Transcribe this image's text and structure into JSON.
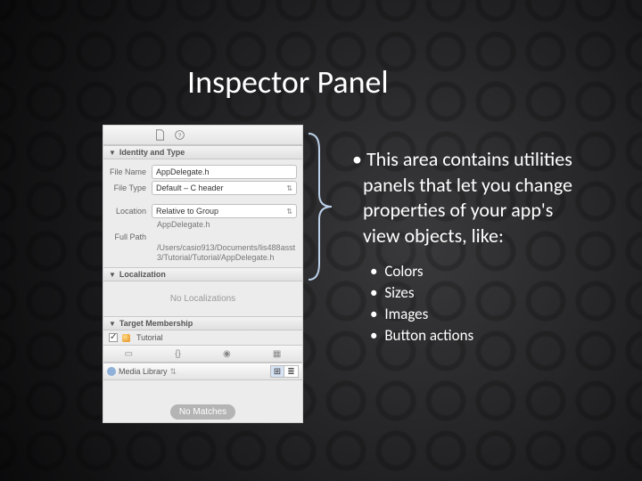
{
  "title": "Inspector Panel",
  "lead": "This area contains utilities panels that let you change properties of your app's view objects, like:",
  "bullets": [
    "Colors",
    "Sizes",
    "Images",
    "Button actions"
  ],
  "panel": {
    "sections": {
      "identity": "Identity and Type",
      "localization": "Localization",
      "target": "Target Membership",
      "media": "Media Library"
    },
    "identity": {
      "file_name_label": "File Name",
      "file_name_value": "AppDelegate.h",
      "file_type_label": "File Type",
      "file_type_value": "Default – C header",
      "location_label": "Location",
      "location_value": "Relative to Group",
      "location_path": "AppDelegate.h",
      "full_path_label": "Full Path",
      "full_path_value": "/Users/casio913/Documents/lis488asst3/Tutorial/Tutorial/AppDelegate.h"
    },
    "localization": {
      "empty": "No Localizations"
    },
    "target": {
      "item": "Tutorial"
    },
    "library": {
      "no_matches": "No Matches"
    }
  }
}
